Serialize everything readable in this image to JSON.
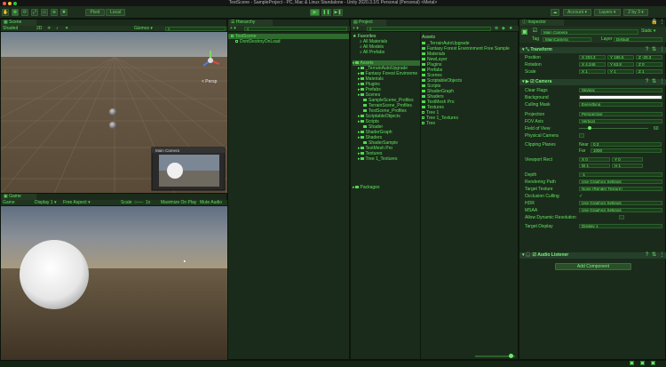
{
  "window": {
    "title": "TestScene - SampleProject - PC, Mac & Linux Standalone - Unity 2020.3.1f1 Personal (Personal) <Metal>"
  },
  "toolbar": {
    "pivot": "Pivot",
    "local": "Local",
    "account": "Account",
    "layers": "Layers",
    "layout": "2 by 3"
  },
  "scene": {
    "tab": "Scene",
    "mode": "Shaded",
    "mode2": "2D",
    "persp": "< Persp",
    "camera_preview": "Main Camera"
  },
  "game": {
    "tab": "Game",
    "display": "Game",
    "display2": "Display 1",
    "aspect": "Free Aspect",
    "scale_label": "Scale",
    "scale_val": "1x",
    "maximize": "Maximize On Play",
    "mute": "Mute Audio"
  },
  "hierarchy": {
    "tab": "Hierarchy",
    "items": [
      "TestScene",
      "DontDestroyOnLoad"
    ]
  },
  "project": {
    "tab": "Project",
    "favorites": {
      "label": "Favorites",
      "items": [
        "All Materials",
        "All Models",
        "All Prefabs"
      ]
    },
    "tree": [
      {
        "label": "Assets",
        "indent": 0,
        "sel": true
      },
      {
        "label": "_TerrainAutoUpgrade",
        "indent": 1
      },
      {
        "label": "Fantasy Forest Environme",
        "indent": 1
      },
      {
        "label": "Materials",
        "indent": 1
      },
      {
        "label": "Plugins",
        "indent": 1
      },
      {
        "label": "Prefabs",
        "indent": 1
      },
      {
        "label": "Scenes",
        "indent": 1
      },
      {
        "label": "SampleScene_Profiles",
        "indent": 2
      },
      {
        "label": "TerrainScene_Profiles",
        "indent": 2
      },
      {
        "label": "TestScene_Profiles",
        "indent": 2
      },
      {
        "label": "ScriptableObjects",
        "indent": 1
      },
      {
        "label": "Scripts",
        "indent": 1
      },
      {
        "label": "Shader",
        "indent": 2
      },
      {
        "label": "ShaderGraph",
        "indent": 1
      },
      {
        "label": "Shaders",
        "indent": 1
      },
      {
        "label": "ShaderSample",
        "indent": 2
      },
      {
        "label": "TextMesh Pro",
        "indent": 1
      },
      {
        "label": "Textures",
        "indent": 1
      },
      {
        "label": "Tree 1_Textures",
        "indent": 1
      },
      {
        "label": "Packages",
        "indent": 0
      }
    ],
    "assets_header": "Assets",
    "assets": [
      "_TerrainAutoUpgrade",
      "Fantasy Forest Environment Free Sample",
      "Materials",
      "NewLayer",
      "Plugins",
      "Prefabs",
      "Scenes",
      "ScriptableObjects",
      "Scripts",
      "ShaderGraph",
      "Shaders",
      "TextMesh Pro",
      "Textures",
      "Tree 1",
      "Tree 1_Textures",
      "Tree"
    ]
  },
  "inspector": {
    "tab": "Inspector",
    "static": "Static",
    "name": "Main Camera",
    "tag_label": "Tag",
    "tag": "MainCamera",
    "layer_label": "Layer",
    "layer": "Default",
    "transform": {
      "title": "Transform",
      "position": {
        "label": "Position",
        "x": "X 203.3",
        "y": "Y 195.6",
        "z": "Z -20.3"
      },
      "rotation": {
        "label": "Rotation",
        "x": "X 4.246",
        "y": "Y 63.8",
        "z": "Z 0"
      },
      "scale": {
        "label": "Scale",
        "x": "X 1",
        "y": "Y 1",
        "z": "Z 1"
      }
    },
    "camera": {
      "title": "Camera",
      "rows": [
        {
          "label": "Clear Flags",
          "value": "Skybox"
        },
        {
          "label": "Background",
          "value": ""
        },
        {
          "label": "Culling Mask",
          "value": "Everything"
        },
        {
          "label": "Projection",
          "value": "Perspective"
        },
        {
          "label": "FOV Axis",
          "value": "Vertical"
        },
        {
          "label": "Field of View",
          "value": "60"
        },
        {
          "label": "Physical Camera",
          "value": ""
        }
      ],
      "clipping": {
        "label": "Clipping Planes",
        "near_label": "Near",
        "near": "0.3",
        "far_label": "Far",
        "far": "1000"
      },
      "viewport": {
        "label": "Viewport Rect",
        "x": "X 0",
        "y": "Y 0",
        "w": "W 1",
        "h": "H 1"
      },
      "rows2": [
        {
          "label": "Depth",
          "value": "-1"
        },
        {
          "label": "Rendering Path",
          "value": "Use Graphics Settings"
        },
        {
          "label": "Target Texture",
          "value": "None (Render Texture)"
        },
        {
          "label": "Occlusion Culling",
          "value": "✓"
        },
        {
          "label": "HDR",
          "value": "Use Graphics Settings"
        },
        {
          "label": "MSAA",
          "value": "Use Graphics Settings"
        },
        {
          "label": "Allow Dynamic Resolution",
          "value": ""
        },
        {
          "label": "Target Display",
          "value": "Display 1"
        }
      ]
    },
    "audio": {
      "title": "Audio Listener"
    },
    "add_component": "Add Component"
  }
}
